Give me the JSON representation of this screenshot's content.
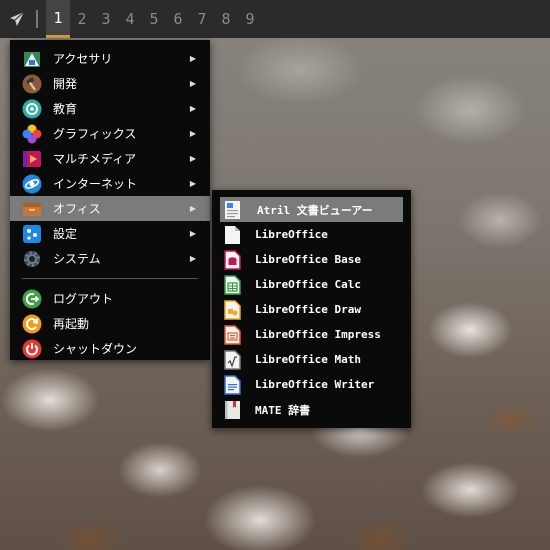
{
  "panel": {
    "workspaces": [
      "1",
      "2",
      "3",
      "4",
      "5",
      "6",
      "7",
      "8",
      "9"
    ],
    "active_workspace": "1",
    "launcher_icon": "paper-plane-icon"
  },
  "main_menu": {
    "items": [
      {
        "label": "アクセサリ",
        "icon": "accessories-icon"
      },
      {
        "label": "開発",
        "icon": "hammer-icon"
      },
      {
        "label": "教育",
        "icon": "education-icon"
      },
      {
        "label": "グラフィックス",
        "icon": "graphics-icon"
      },
      {
        "label": "マルチメディア",
        "icon": "multimedia-icon"
      },
      {
        "label": "インターネット",
        "icon": "internet-icon"
      },
      {
        "label": "オフィス",
        "icon": "office-icon"
      },
      {
        "label": "設定",
        "icon": "settings-icon"
      },
      {
        "label": "システム",
        "icon": "system-icon"
      }
    ],
    "session": [
      {
        "label": "ログアウト",
        "icon": "logout-icon"
      },
      {
        "label": "再起動",
        "icon": "reboot-icon"
      },
      {
        "label": "シャットダウン",
        "icon": "shutdown-icon"
      }
    ],
    "selected": "オフィス"
  },
  "office_submenu": {
    "items": [
      {
        "label": "Atril 文書ビューアー",
        "icon": "document-viewer-icon"
      },
      {
        "label": "LibreOffice",
        "icon": "libreoffice-icon"
      },
      {
        "label": "LibreOffice Base",
        "icon": "libreoffice-base-icon"
      },
      {
        "label": "LibreOffice Calc",
        "icon": "libreoffice-calc-icon"
      },
      {
        "label": "LibreOffice Draw",
        "icon": "libreoffice-draw-icon"
      },
      {
        "label": "LibreOffice Impress",
        "icon": "libreoffice-impress-icon"
      },
      {
        "label": "LibreOffice Math",
        "icon": "libreoffice-math-icon"
      },
      {
        "label": "LibreOffice Writer",
        "icon": "libreoffice-writer-icon"
      },
      {
        "label": "MATE 辞書",
        "icon": "dictionary-icon"
      }
    ],
    "selected": "Atril 文書ビューアー"
  },
  "colors": {
    "panel_bg": "#2b2b2b",
    "menu_bg": "#0a0a0a",
    "highlight": "#7b7b7b",
    "workspace_accent": "#d8a33a"
  }
}
